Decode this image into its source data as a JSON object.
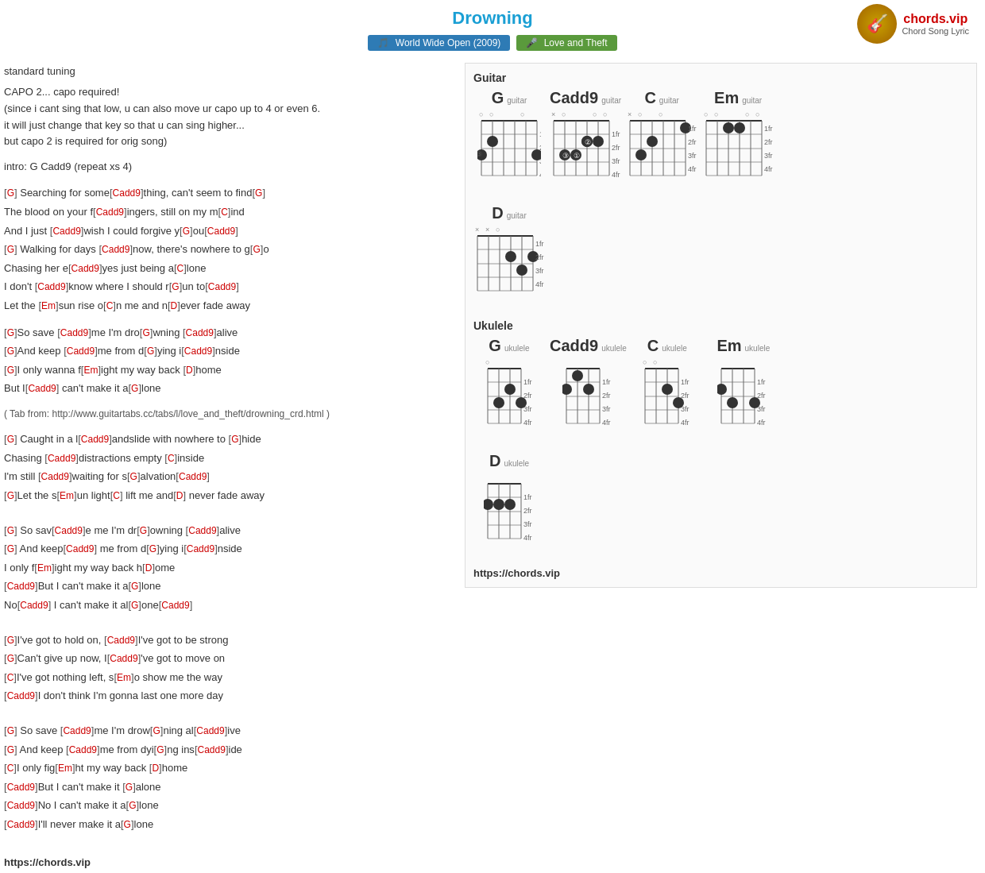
{
  "header": {
    "title": "Drowning",
    "badge_album": "World Wide Open (2009)",
    "badge_artist": "Love and Theft",
    "logo_icon": "🎸",
    "logo_name": "chords.vip",
    "logo_sub": "Chord Song Lyric"
  },
  "left": {
    "tuning": "standard tuning",
    "capo": "CAPO 2... capo required!\n(since i cant sing that low, u can also move ur capo up to 4 or even 6.\nit will just change that key so that u can sing higher...\nbut capo 2 is required for orig song)",
    "intro": "intro: G Cadd9 (repeat xs 4)",
    "lyrics": [
      {
        "type": "verse",
        "lines": [
          {
            "text": "[G] Searching for some[Cadd9]thing, can't seem to find[G]",
            "chords": [
              "G",
              "Cadd9",
              "G"
            ]
          },
          {
            "text": "The blood on your f[Cadd9]ingers, still on my m[C]ind",
            "chords": [
              "Cadd9",
              "C"
            ]
          },
          {
            "text": "And I just [Cadd9]wish I could forgive y[G]ou[Cadd9]",
            "chords": [
              "Cadd9",
              "G",
              "Cadd9"
            ]
          },
          {
            "text": "[G] Walking for days [Cadd9]now, there's nowhere to g[G]o",
            "chords": [
              "G",
              "Cadd9",
              "G"
            ]
          },
          {
            "text": "Chasing her e[Cadd9]yes just being a[C]lone",
            "chords": [
              "Cadd9",
              "C"
            ]
          },
          {
            "text": "I don't [Cadd9]know where I should r[G]un to[Cadd9]",
            "chords": [
              "Cadd9",
              "G",
              "Cadd9"
            ]
          },
          {
            "text": "Let the [Em]sun rise o[C]n me and n[D]ever fade away",
            "chords": [
              "Em",
              "C",
              "D"
            ]
          }
        ]
      },
      {
        "type": "blank"
      },
      {
        "type": "chorus",
        "lines": [
          {
            "text": "[G]So save [Cadd9]me I'm dro[G]wning [Cadd9]alive",
            "chords": [
              "G",
              "Cadd9",
              "G",
              "Cadd9"
            ]
          },
          {
            "text": "[G]And keep [Cadd9]me from d[G]ying i[Cadd9]nside",
            "chords": [
              "G",
              "Cadd9",
              "G",
              "Cadd9"
            ]
          },
          {
            "text": "[G]I only wanna f[Em]ight my way back [D]home",
            "chords": [
              "G",
              "Em",
              "D"
            ]
          },
          {
            "text": "But I[Cadd9] can't make it a[G]lone",
            "chords": [
              "Cadd9",
              "G"
            ]
          }
        ]
      },
      {
        "type": "blank"
      },
      {
        "type": "note",
        "text": "( Tab from: http://www.guitartabs.cc/tabs/l/love_and_theft/drowning_crd.html )"
      },
      {
        "type": "verse2",
        "lines": [
          {
            "text": "[G] Caught in a l[Cadd9]andslide with nowhere to [G]hide",
            "chords": [
              "G",
              "Cadd9",
              "G"
            ]
          },
          {
            "text": "Chasing [Cadd9]distractions empty [C]inside",
            "chords": [
              "Cadd9",
              "C"
            ]
          },
          {
            "text": "I'm still [Cadd9]waiting for s[G]alvation[Cadd9]",
            "chords": [
              "Cadd9",
              "G",
              "Cadd9"
            ]
          },
          {
            "text": "[G]Let the s[Em]un light[C] lift me and[D] never fade away",
            "chords": [
              "G",
              "Em",
              "C",
              "D"
            ]
          }
        ]
      },
      {
        "type": "blank"
      },
      {
        "type": "blank"
      },
      {
        "type": "chorus2",
        "lines": [
          {
            "text": "[G] So sav[Cadd9]e me I'm dr[G]owning [Cadd9]alive",
            "chords": [
              "G",
              "Cadd9",
              "G",
              "Cadd9"
            ]
          },
          {
            "text": "[G] And keep[Cadd9] me from d[G]ying i[Cadd9]nside",
            "chords": [
              "G",
              "Cadd9",
              "G",
              "Cadd9"
            ]
          },
          {
            "text": "I only f[Em]ight my way back h[D]ome",
            "chords": [
              "Em",
              "D"
            ]
          },
          {
            "text": "[Cadd9]But I can't make it a[G]lone",
            "chords": [
              "Cadd9",
              "G"
            ]
          },
          {
            "text": "No[Cadd9] I can't make it al[G]one[Cadd9]",
            "chords": [
              "Cadd9",
              "G",
              "Cadd9"
            ]
          }
        ]
      },
      {
        "type": "blank"
      },
      {
        "type": "blank"
      },
      {
        "type": "bridge",
        "lines": [
          {
            "text": "[G]I've got to hold on, [Cadd9]I've got to be strong",
            "chords": [
              "G",
              "Cadd9"
            ]
          },
          {
            "text": "[G]Can't give up now, I[Cadd9]'ve got to move on",
            "chords": [
              "G",
              "Cadd9"
            ]
          },
          {
            "text": "[C]I've got nothing left, s[Em]o show me the way",
            "chords": [
              "C",
              "Em"
            ]
          },
          {
            "text": "[Cadd9]I don't think I'm gonna last one more day",
            "chords": [
              "Cadd9"
            ]
          }
        ]
      },
      {
        "type": "blank"
      },
      {
        "type": "blank"
      },
      {
        "type": "outro",
        "lines": [
          {
            "text": "[G] So save [Cadd9]me I'm drow[G]ning al[Cadd9]ive",
            "chords": [
              "G",
              "Cadd9",
              "G",
              "Cadd9"
            ]
          },
          {
            "text": "[G] And keep [Cadd9]me from dyi[G]ng ins[Cadd9]ide",
            "chords": [
              "G",
              "Cadd9",
              "G",
              "Cadd9"
            ]
          },
          {
            "text": "[C]I only fig[Em]ht my way back [D]home",
            "chords": [
              "C",
              "Em",
              "D"
            ]
          },
          {
            "text": "[Cadd9]But I can't make it [G]alone",
            "chords": [
              "Cadd9",
              "G"
            ]
          },
          {
            "text": "[Cadd9]No I can't make it a[G]lone",
            "chords": [
              "Cadd9",
              "G"
            ]
          },
          {
            "text": "[Cadd9]I'll never make it a[G]lone",
            "chords": [
              "Cadd9",
              "G"
            ]
          }
        ]
      }
    ]
  },
  "right": {
    "guitar_title": "Guitar",
    "ukulele_title": "Ukulele",
    "site_url": "https://chords.vip"
  },
  "bottom_url": "https://chords.vip"
}
